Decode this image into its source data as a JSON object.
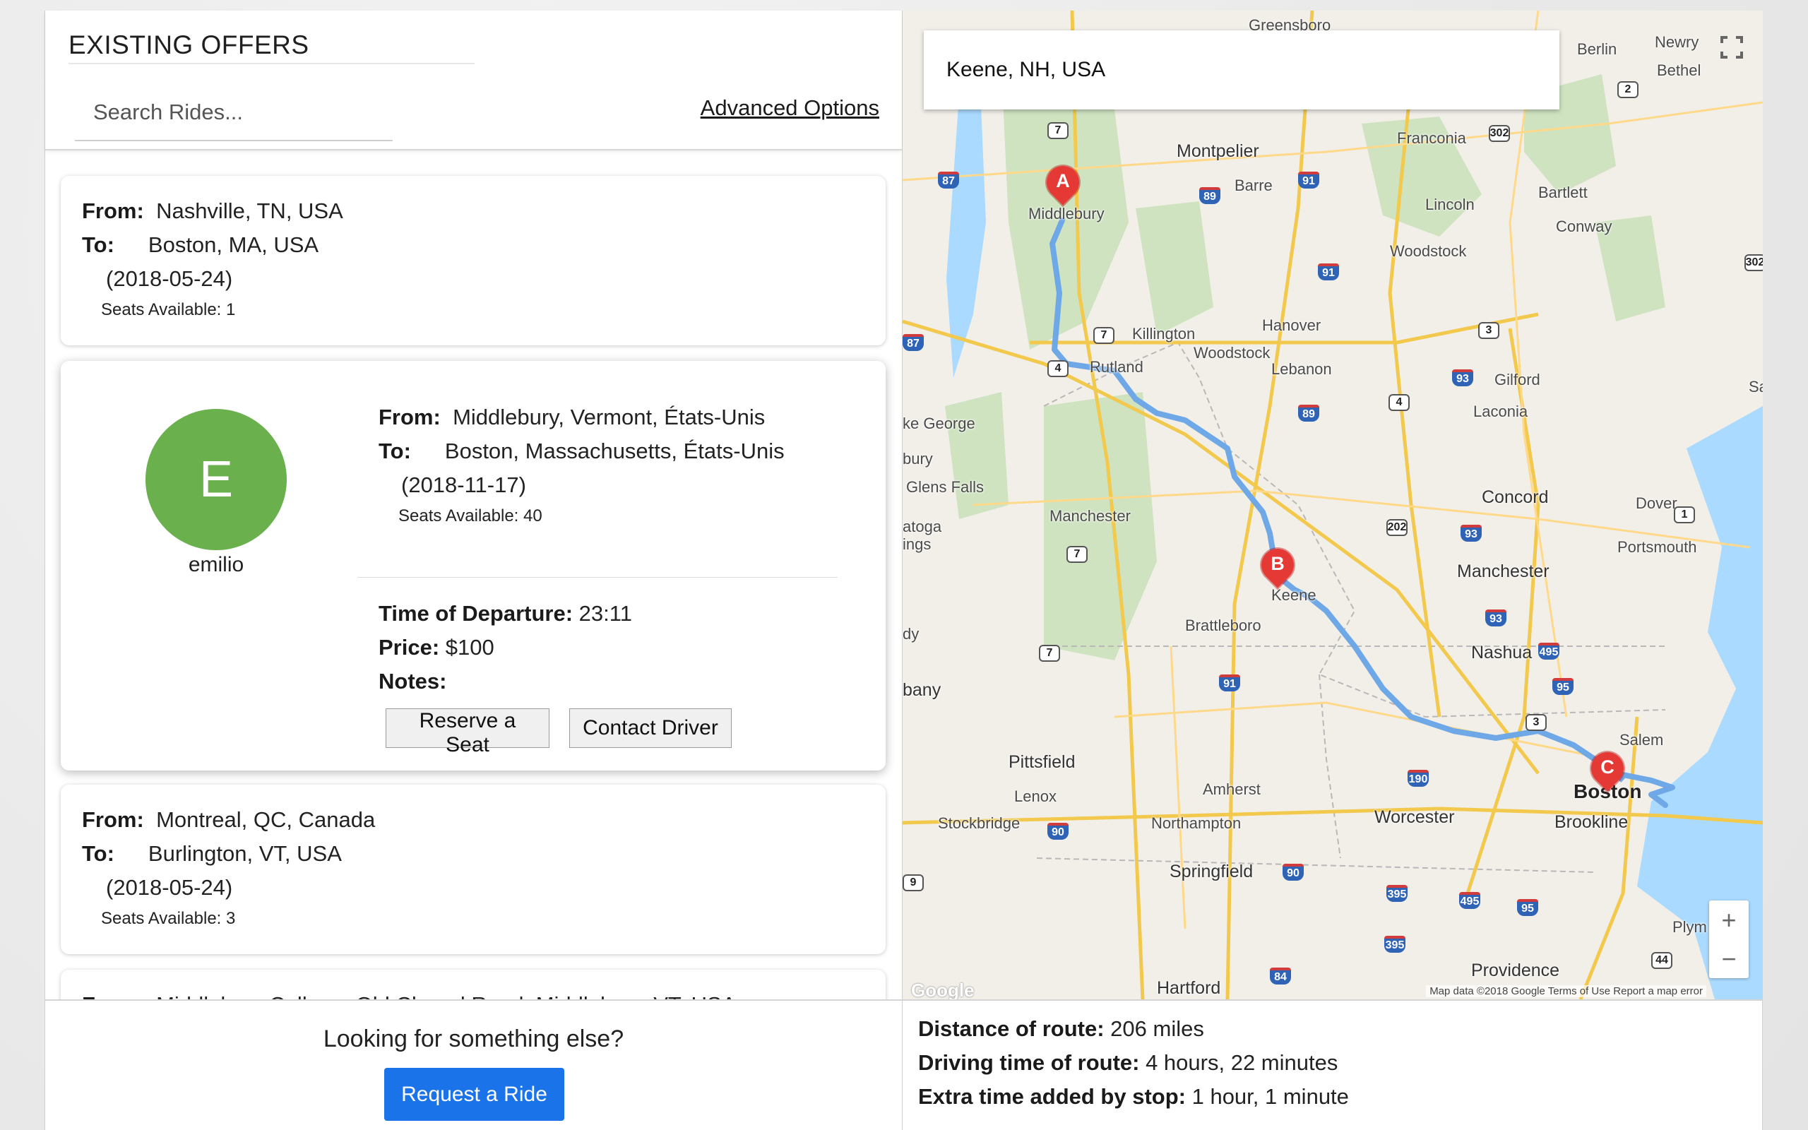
{
  "offers": {
    "title": "EXISTING OFFERS",
    "search_placeholder": "Search Rides...",
    "advanced_label": "Advanced Options",
    "labels": {
      "from": "From:",
      "to": "To:",
      "seats_prefix": "Seats Available: ",
      "departure": "Time of Departure:",
      "price": "Price:",
      "notes": "Notes:"
    },
    "cards": [
      {
        "from": "Nashville, TN, USA",
        "to": "Boston, MA, USA",
        "date": "(2018-05-24)",
        "seats": "Seats Available: 1"
      },
      {
        "from": "Middlebury, Vermont, États-Unis",
        "to": "Boston, Massachusetts, États-Unis",
        "date": "(2018-11-17)",
        "seats": "Seats Available: 40",
        "avatar_letter": "E",
        "avatar_color": "#6ab04c",
        "driver": "emilio",
        "departure": "23:11",
        "price": "$100",
        "notes": "",
        "reserve_label": "Reserve a Seat",
        "contact_label": "Contact Driver"
      },
      {
        "from": "Montreal, QC, Canada",
        "to": "Burlington, VT, USA",
        "date": "(2018-05-24)",
        "seats": "Seats Available: 3"
      },
      {
        "from": "Middlebury College, Old Chapel Road, Middlebury, VT, USA"
      }
    ]
  },
  "footer": {
    "prompt": "Looking for something else?",
    "request_label": "Request a Ride",
    "accent": "#1a73e8"
  },
  "map": {
    "search_value": "Keene, NH, USA",
    "zoom_in": "+",
    "zoom_out": "−",
    "google": "Google",
    "credit": "Map data ©2018 Google  Terms of Use  Report a map error",
    "markers": [
      "A",
      "B",
      "C"
    ],
    "route_color": "#6fa8e6",
    "places": {
      "greensboro": "Greensboro",
      "newry": "Newry",
      "berlin": "Berlin",
      "bethel": "Bethel",
      "franconia": "Franconia",
      "montpelier": "Montpelier",
      "barre": "Barre",
      "bartlett": "Bartlett",
      "middlebury": "Middlebury",
      "lincoln": "Lincoln",
      "conway": "Conway",
      "woodstock_nh": "Woodstock",
      "killington": "Killington",
      "hanover": "Hanover",
      "woodstock_vt": "Woodstock",
      "rutland": "Rutland",
      "lebanon": "Lebanon",
      "gilford": "Gilford",
      "laconia": "Laconia",
      "lake_george": "ke George",
      "glens_falls": "Glens Falls",
      "bury": "bury",
      "manchester_vt": "Manchester",
      "concord": "Concord",
      "dover": "Dover",
      "portsmouth": "Portsmouth",
      "ratoga": "atoga",
      "rings": "ings",
      "keene": "Keene",
      "manchester_nh": "Manchester",
      "brattleboro": "Brattleboro",
      "nashua": "Nashua",
      "dy": "dy",
      "bany": "bany",
      "pittsfield": "Pittsfield",
      "salem": "Salem",
      "lenox": "Lenox",
      "amherst": "Amherst",
      "boston": "Boston",
      "stockbridge": "Stockbridge",
      "northampton": "Northampton",
      "worcester": "Worcester",
      "brookline": "Brookline",
      "springfield": "Springfield",
      "plym": "Plym",
      "providence": "Providence",
      "hartford": "Hartford",
      "sa": "Sa"
    },
    "shields": {
      "i87a": "87",
      "i89a": "89",
      "i91a": "91",
      "i91b": "91",
      "i87b": "87",
      "i89b": "89",
      "i93a": "93",
      "i93b": "93",
      "i93c": "93",
      "i91c": "91",
      "i495": "495",
      "i95a": "95",
      "i90a": "90",
      "i90b": "90",
      "i190": "190",
      "i495b": "495",
      "i95b": "95",
      "i84": "84",
      "i395a": "395",
      "i395b": "395",
      "us2": "2",
      "us302a": "302",
      "us302b": "302",
      "us7a": "7",
      "us7b": "7",
      "us7c": "7",
      "us7d": "7",
      "us4a": "4",
      "us4b": "4",
      "us3a": "3",
      "us3b": "3",
      "us202": "202",
      "us1": "1",
      "us44": "44",
      "us9": "9"
    }
  },
  "route": {
    "distance_label": "Distance of route:",
    "distance_value": "206 miles",
    "time_label": "Driving time of route:",
    "time_value": "4 hours, 22 minutes",
    "extra_label": "Extra time added by stop:",
    "extra_value": "1 hour, 1 minute"
  }
}
